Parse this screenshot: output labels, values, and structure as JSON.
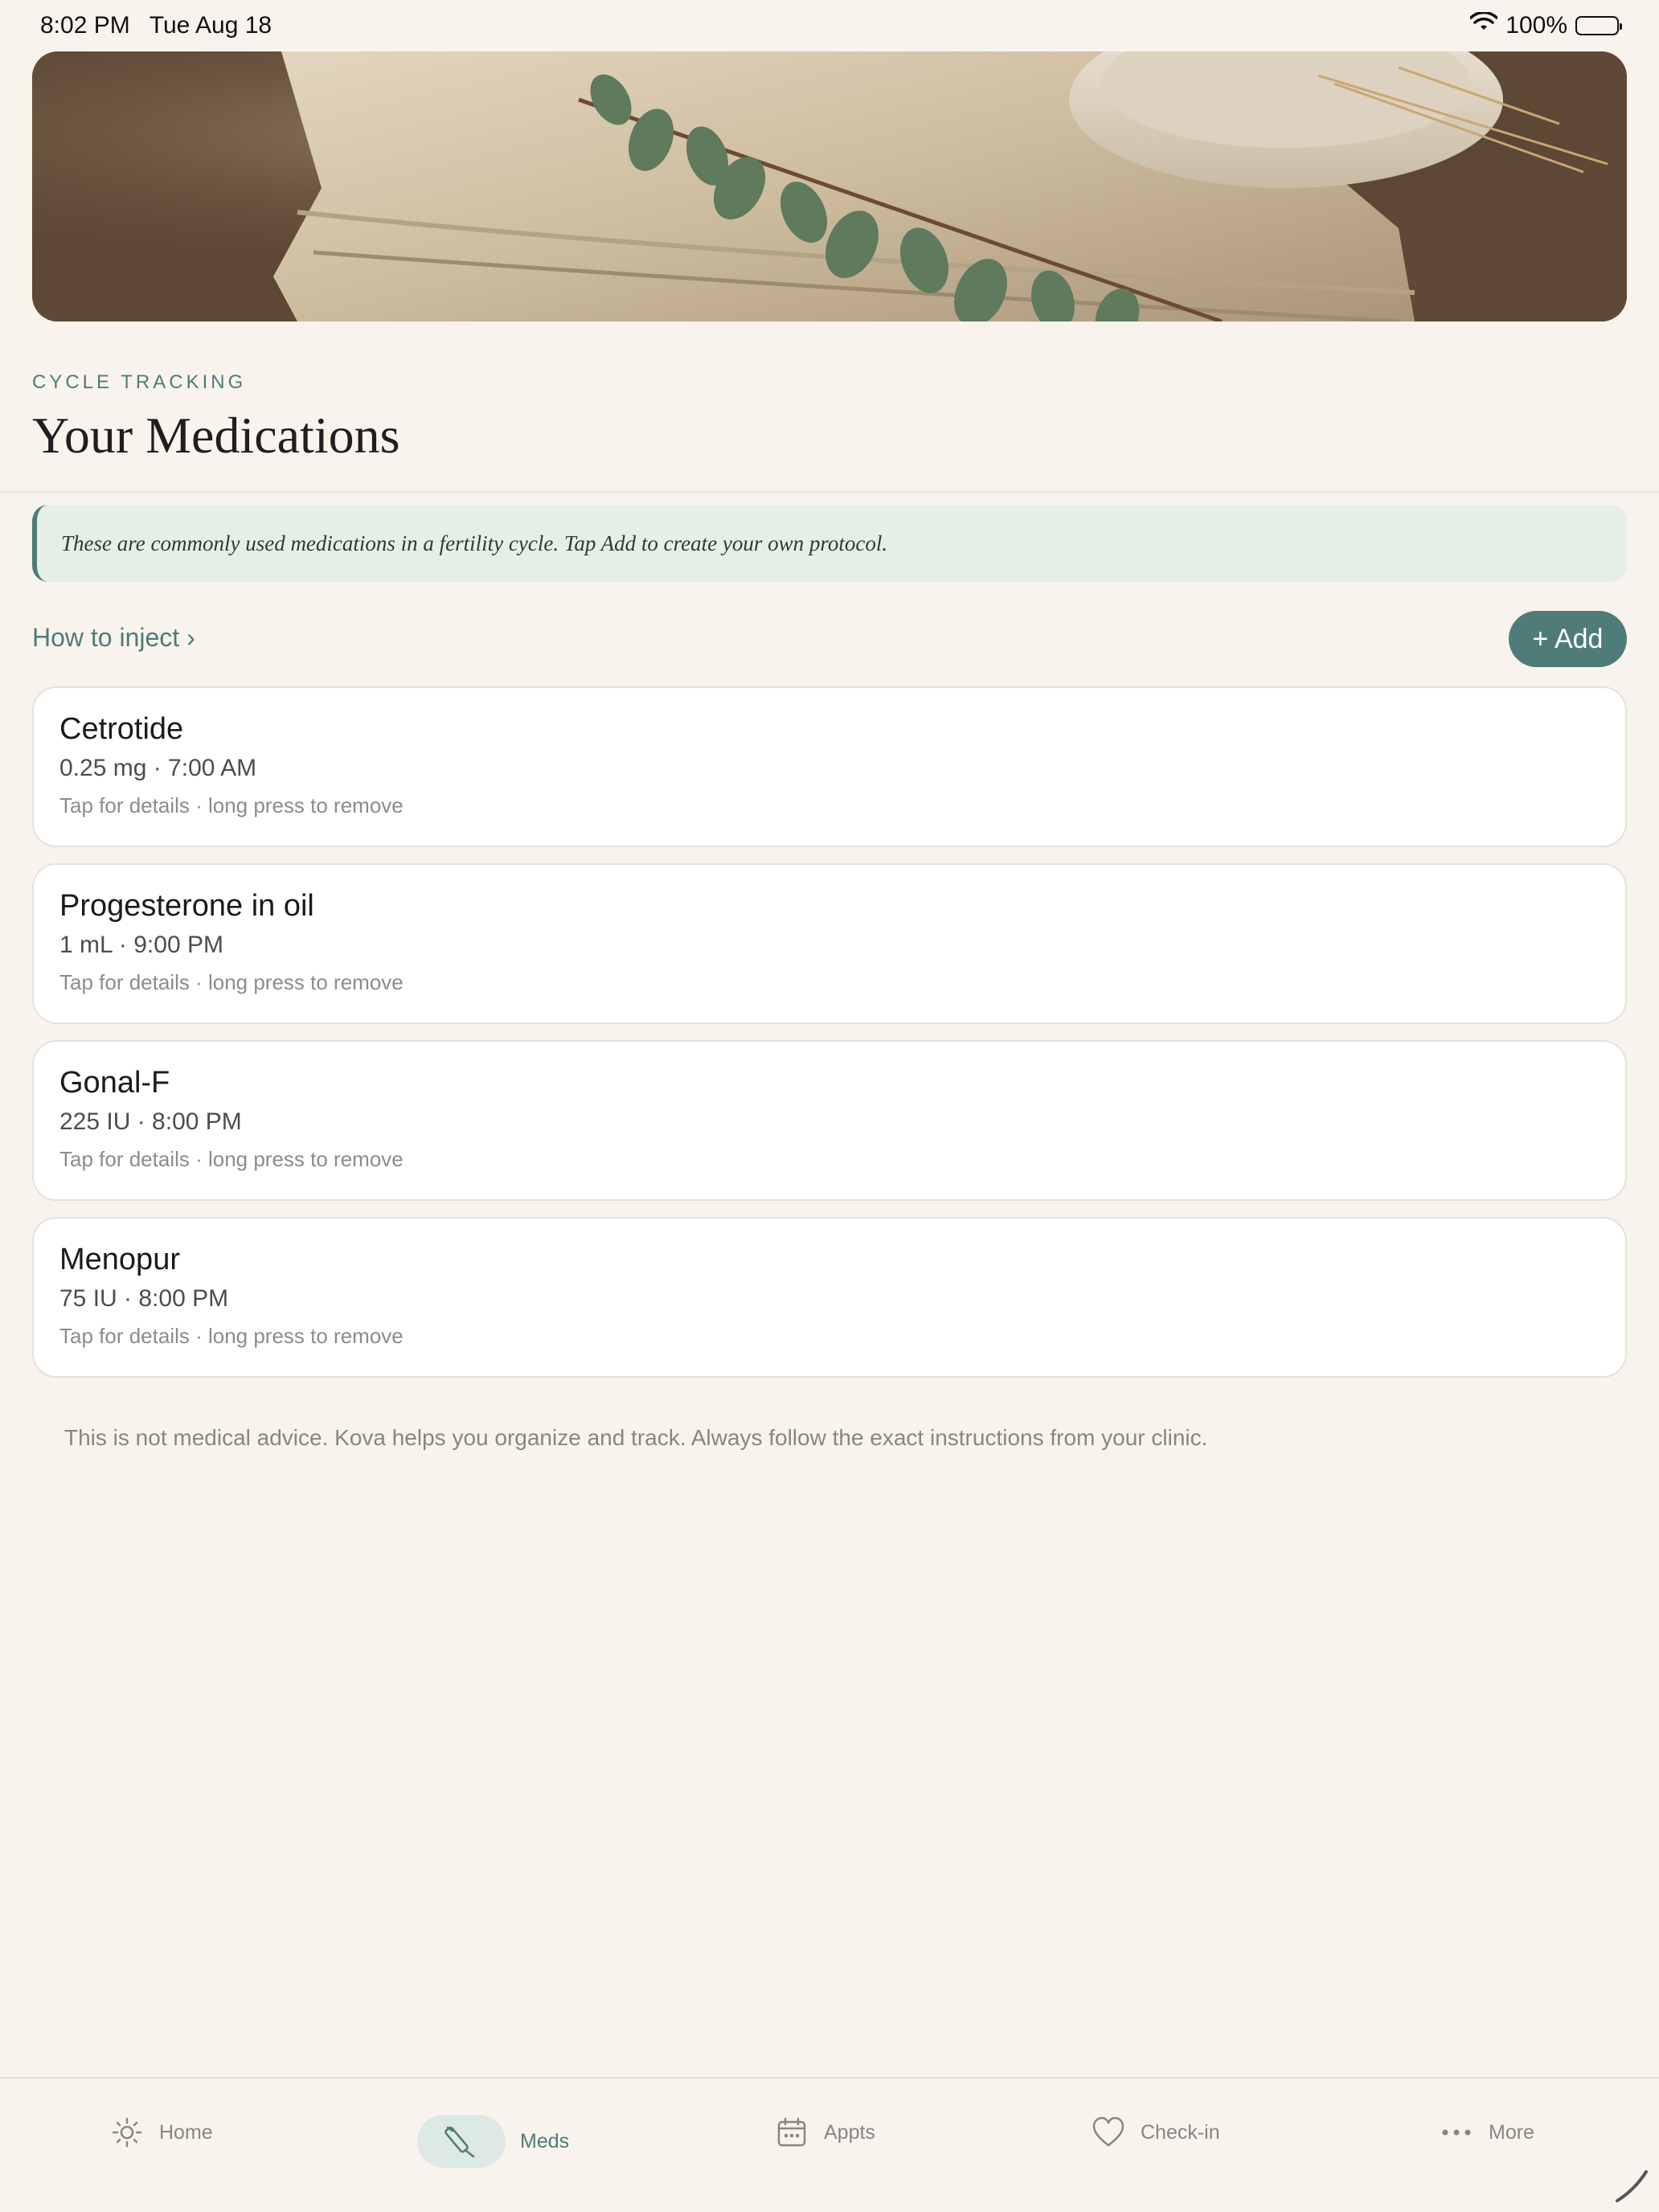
{
  "status_bar": {
    "time": "8:02 PM",
    "date": "Tue Aug 18",
    "battery": "100%"
  },
  "header": {
    "eyebrow": "CYCLE TRACKING",
    "title": "Your Medications"
  },
  "notice": {
    "text": "These are commonly used medications in a fertility cycle. Tap Add to create your own protocol."
  },
  "actions": {
    "how_to_inject": "How to inject ›",
    "add_label": "+ Add"
  },
  "medications": [
    {
      "name": "Cetrotide",
      "detail": "0.25 mg · 7:00 AM",
      "hint": "Tap for details · long press to remove"
    },
    {
      "name": "Progesterone in oil",
      "detail": "1 mL · 9:00 PM",
      "hint": "Tap for details · long press to remove"
    },
    {
      "name": "Gonal-F",
      "detail": "225 IU · 8:00 PM",
      "hint": "Tap for details · long press to remove"
    },
    {
      "name": "Menopur",
      "detail": "75 IU · 8:00 PM",
      "hint": "Tap for details · long press to remove"
    }
  ],
  "disclaimer": "This is not medical advice. Kova helps you organize and track. Always follow the exact instructions from your clinic.",
  "tabs": [
    {
      "label": "Home",
      "icon": "sun-icon",
      "active": false
    },
    {
      "label": "Meds",
      "icon": "syringe-icon",
      "active": true
    },
    {
      "label": "Appts",
      "icon": "calendar-icon",
      "active": false
    },
    {
      "label": "Check-in",
      "icon": "heart-icon",
      "active": false
    },
    {
      "label": "More",
      "icon": "ellipsis-icon",
      "active": false
    }
  ],
  "colors": {
    "background": "#f9f3ee",
    "accent": "#4f7c75",
    "notice_bg": "#e6eee8",
    "card_bg": "#ffffff"
  }
}
